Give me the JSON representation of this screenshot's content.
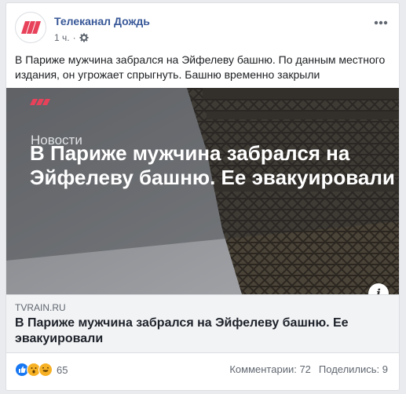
{
  "post": {
    "page_name": "Телеканал Дождь",
    "time": "1 ч.",
    "separator": "·",
    "text": "В Париже мужчина забрался на Эйфелеву башню. По данным местного издания, он угрожает спрыгнуть. Башню временно закрыли"
  },
  "image": {
    "category": "Новости",
    "headline": "В Париже мужчина забрался на Эйфелеву башню. Ее эвакуировали"
  },
  "link": {
    "domain": "TVRAIN.RU",
    "title": "В Париже мужчина забрался на Эйфелеву башню. Ее эвакуировали"
  },
  "footer": {
    "reaction_count": "65",
    "comments": "Комментарии: 72",
    "shares": "Поделились: 9"
  },
  "icons": {
    "brand": "tv-rain-logo",
    "settings": "gear-icon",
    "more": "more-options-icon",
    "info": "info-icon",
    "reactions": [
      "like-icon",
      "wow-icon",
      "haha-icon"
    ]
  },
  "colors": {
    "page_name": "#385898",
    "brand_logo": "#e8425a",
    "like": "#1877f2",
    "emoji": "#f7b125"
  }
}
